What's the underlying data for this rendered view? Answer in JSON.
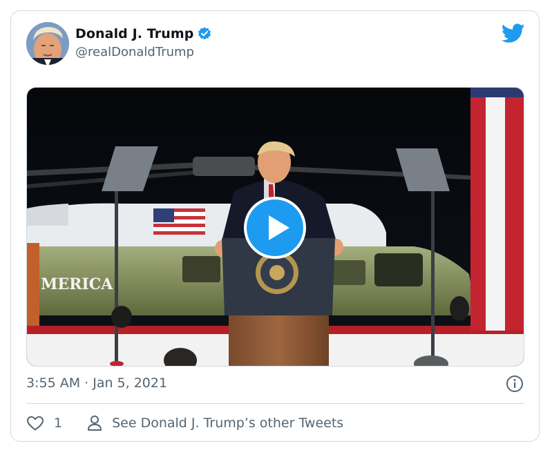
{
  "tweet": {
    "display_name": "Donald J. Trump",
    "handle": "@realDonaldTrump",
    "timestamp": "3:55 AM · Jan 5, 2021",
    "like_count": "1",
    "other_tweets_label": "See Donald J. Trump’s other Tweets"
  },
  "media": {
    "helicopter_text": "MERICA"
  },
  "colors": {
    "accent": "#1d9bf0",
    "text_primary": "#0f1419",
    "text_secondary": "#536471",
    "border": "#cfd9de"
  },
  "icons": {
    "verified": "verified-badge-icon",
    "brand": "twitter-bird-icon",
    "play": "play-icon",
    "info": "info-icon",
    "like": "heart-icon",
    "profile": "person-icon"
  }
}
